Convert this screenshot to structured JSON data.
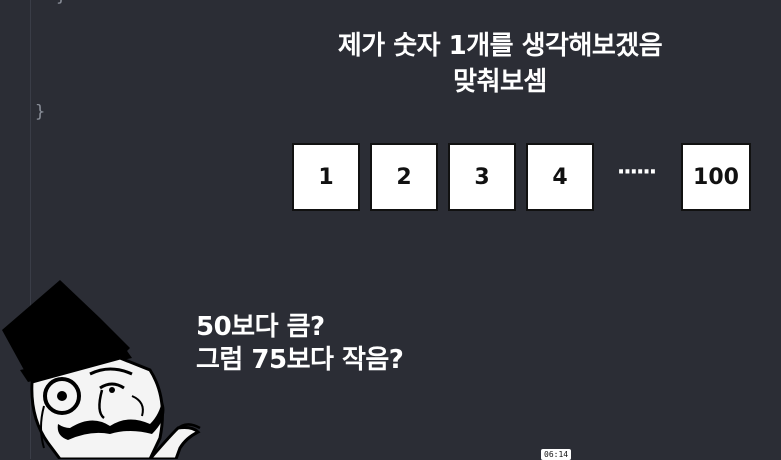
{
  "code": {
    "brace_top": "}",
    "brace_bottom": "}"
  },
  "headline": {
    "line1": "제가 숫자 1개를 생각해보겠음",
    "line2": "맞춰보셈"
  },
  "number_boxes": [
    "1",
    "2",
    "3",
    "4",
    "100"
  ],
  "ellipsis": "······",
  "questions": {
    "line1": "50보다 큼?",
    "line2": "그럼 75보다 작음?"
  },
  "timestamp": "06:14",
  "colors": {
    "background": "#2b2d35",
    "box_fill": "#ffffff",
    "text": "#ffffff"
  }
}
